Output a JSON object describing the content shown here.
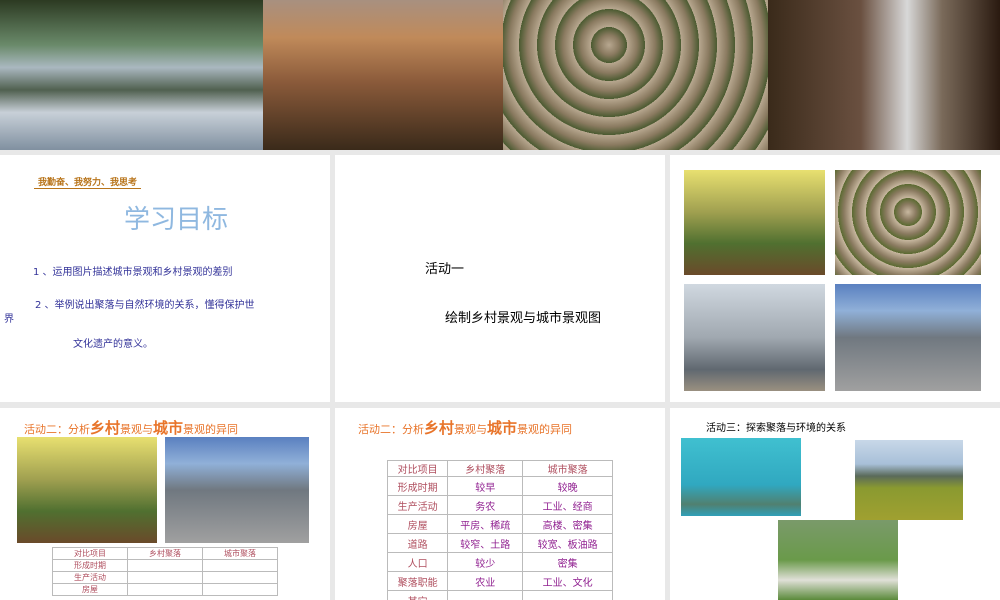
{
  "banner": {
    "photos": [
      "lake-bridge-photo",
      "city-skyline-photo",
      "thatched-village-photo",
      "old-street-photo"
    ]
  },
  "slide1": {
    "motto": "我勤奋、我努力、我思考",
    "title": "学习目标",
    "goal1": "1 、运用图片描述城市景观和乡村景观的差别",
    "goal2a": "2 、举例说出聚落与自然环境的关系，懂得保护世",
    "goal2b": "界",
    "goal2c": "文化遗产的意义。"
  },
  "slide2": {
    "activity": "活动一",
    "task": "绘制乡村景观与城市景观图"
  },
  "slide4": {
    "title_a": "活动二：分析",
    "title_b": "乡村",
    "title_c": "景观与",
    "title_d": "城市",
    "title_e": "景观的异同",
    "headers": [
      "对比项目",
      "乡村聚落",
      "城市聚落"
    ],
    "rows": [
      "形成时期",
      "生产活动",
      "房屋"
    ]
  },
  "slide5": {
    "title_a": "活动二：分析",
    "title_b": "乡村",
    "title_c": "景观与",
    "title_d": "城市",
    "title_e": "景观的异同",
    "headers": [
      "对比项目",
      "乡村聚落",
      "城市聚落"
    ],
    "rows": [
      [
        "形成时期",
        "较早",
        "较晚"
      ],
      [
        "生产活动",
        "务农",
        "工业、经商"
      ],
      [
        "房屋",
        "平房、稀疏",
        "高楼、密集"
      ],
      [
        "道路",
        "较窄、土路",
        "较宽、板油路"
      ],
      [
        "人口",
        "较少",
        "密集"
      ],
      [
        "聚落职能",
        "农业",
        "工业、文化"
      ],
      [
        "其它",
        "",
        ""
      ]
    ]
  },
  "slide6": {
    "title": "活动三：探索聚落与环境的关系"
  }
}
